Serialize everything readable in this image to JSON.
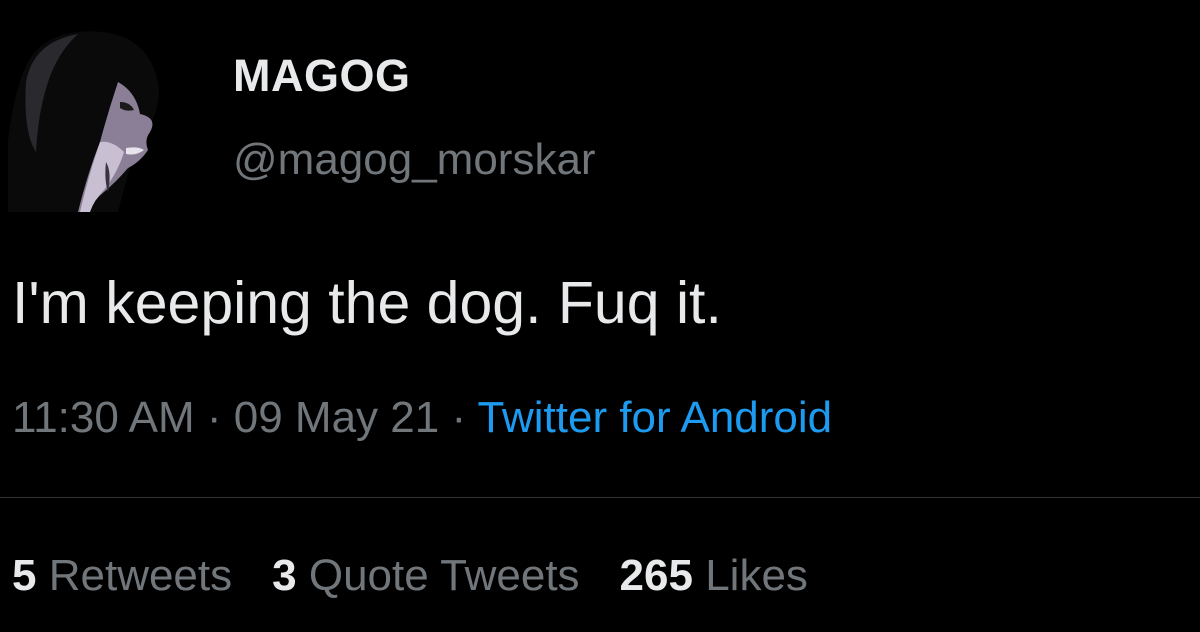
{
  "author": {
    "display_name": "MAGOG",
    "handle": "@magog_morskar"
  },
  "tweet": {
    "text": "I'm keeping the dog. Fuq it."
  },
  "meta": {
    "time": "11:30 AM",
    "sep1": " · ",
    "date": "09 May 21",
    "sep2": " · ",
    "source": "Twitter for Android"
  },
  "stats": {
    "retweets_count": "5",
    "retweets_label": "Retweets",
    "quotes_count": "3",
    "quotes_label": "Quote Tweets",
    "likes_count": "265",
    "likes_label": "Likes"
  },
  "colors": {
    "background": "#000000",
    "primary_text": "#e7e9ea",
    "secondary_text": "#71767b",
    "link": "#1d9bf0",
    "divider": "#2f3336"
  }
}
